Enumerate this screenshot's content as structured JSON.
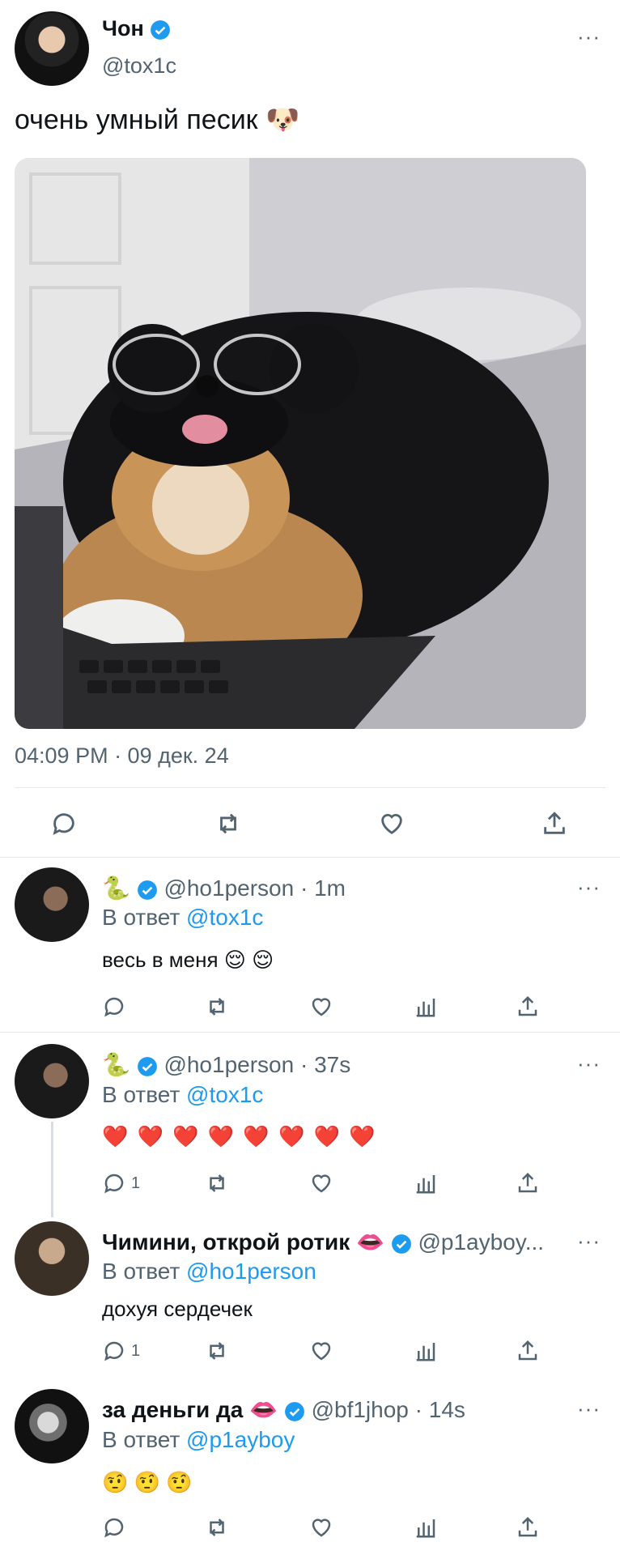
{
  "main_tweet": {
    "display_name": "Чон",
    "handle": "@tox1c",
    "text": "очень умный песик 🐶",
    "timestamp": "04:09 PM · 09 дек. 24",
    "more_label": "···"
  },
  "replies": [
    {
      "name": "🐍",
      "handle": "@ho1person",
      "time": "· 1m",
      "reply_prefix": "В ответ",
      "reply_to": "@tox1c",
      "text": "весь в меня 😌 😌",
      "reply_count": ""
    },
    {
      "name": "🐍",
      "handle": "@ho1person",
      "time": "· 37s",
      "reply_prefix": "В ответ",
      "reply_to": "@tox1c",
      "text": "❤️ ❤️ ❤️ ❤️ ❤️ ❤️ ❤️ ❤️",
      "reply_count": "1"
    },
    {
      "name": "Чимини, открой ротик 👄",
      "handle": "@p1ayboy...",
      "time": "",
      "reply_prefix": "В ответ",
      "reply_to": "@ho1person",
      "text": "дохуя сердечек",
      "reply_count": "1"
    },
    {
      "name": "за деньги да 👄",
      "handle": "@bf1jhop",
      "time": "· 14s",
      "reply_prefix": "В ответ",
      "reply_to": "@p1ayboy",
      "text": "🤨 🤨 🤨",
      "reply_count": ""
    }
  ],
  "colors": {
    "accent": "#1d9bf0",
    "muted": "#536471",
    "text": "#0f1419"
  }
}
